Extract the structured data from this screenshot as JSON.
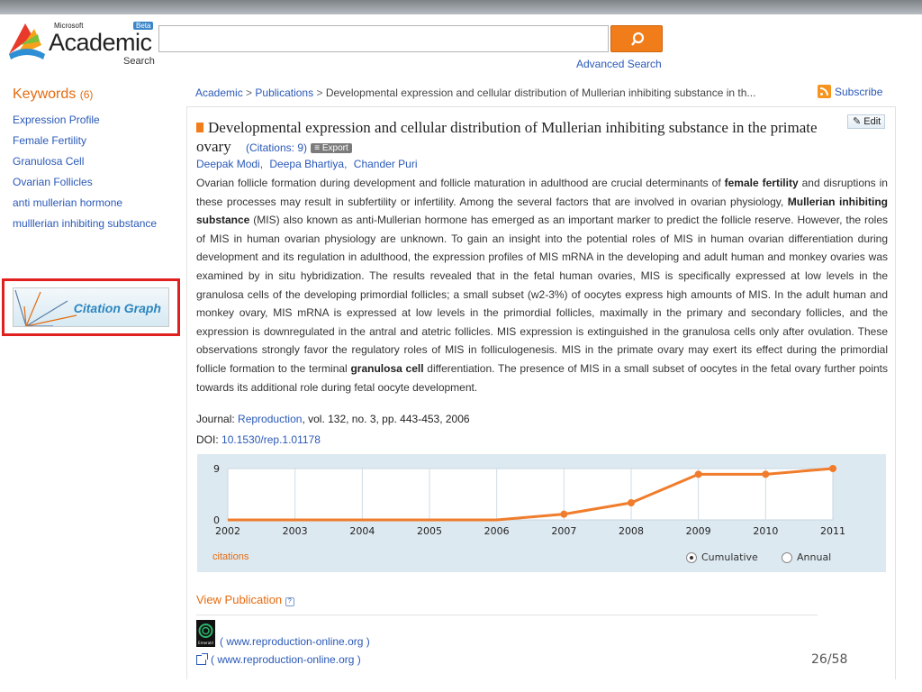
{
  "header": {
    "logo_brand": "Microsoft",
    "logo_beta": "Beta",
    "logo_main": "Academic",
    "logo_sub": "Search",
    "search_value": "",
    "advanced_search": "Advanced Search"
  },
  "keywords": {
    "title": "Keywords",
    "count": "(6)",
    "items": [
      "Expression Profile",
      "Female Fertility",
      "Granulosa Cell",
      "Ovarian Follicles",
      "anti mullerian hormone",
      "mulllerian inhibiting substance"
    ]
  },
  "citation_graph": {
    "label": "Citation Graph"
  },
  "breadcrumb": {
    "items": [
      "Academic",
      "Publications"
    ],
    "current": "Developmental expression and cellular distribution of Mullerian inhibiting substance in th...",
    "separator": ">"
  },
  "subscribe": "Subscribe",
  "edit": "Edit",
  "publication": {
    "title": "Developmental expression and cellular distribution of Mullerian inhibiting substance in the primate ovary",
    "citations": "(Citations: 9)",
    "export": "Export",
    "authors": [
      "Deepak Modi,",
      "Deepa Bhartiya,",
      "Chander Puri"
    ],
    "abstract_parts": [
      "Ovarian follicle formation during development and follicle maturation in adulthood are crucial determinants of ",
      "female fertility",
      " and disruptions in these processes may result in subfertility or infertility. Among the several factors that are involved in ovarian physiology, ",
      "Mullerian inhibiting substance",
      " (MIS) also known as anti-Mullerian hormone has emerged as an important marker to predict the follicle reserve. However, the roles of MIS in human ovarian physiology are unknown. To gain an insight into the potential roles of MIS in human ovarian differentiation during development and its regulation in adulthood, the expression profiles of MIS mRNA in the developing and adult human and monkey ovaries was examined by in situ hybridization. The results revealed that in the fetal human ovaries, MIS is specifically expressed at low levels in the granulosa cells of the developing primordial follicles; a small subset (w2-3%) of oocytes express high amounts of MIS. In the adult human and monkey ovary, MIS mRNA is expressed at low levels in the primordial follicles, maximally in the primary and secondary follicles, and the expression is downregulated in the antral and atetric follicles. MIS expression is extinguished in the granulosa cells only after ovulation. These observations strongly favor the regulatory roles of MIS in folliculogenesis. MIS in the primate ovary may exert its effect during the primordial follicle formation to the terminal ",
      "granulosa cell",
      " differentiation. The presence of MIS in a small subset of oocytes in the fetal ovary further points towards its additional role during fetal oocyte development."
    ],
    "journal_label": "Journal:",
    "journal_name": "Reproduction",
    "journal_details": ", vol. 132, no. 3, pp. 443-453, 2006",
    "doi_label": "DOI:",
    "doi": "10.1530/rep.1.01178"
  },
  "chart_data": {
    "type": "line",
    "x": [
      "2002",
      "2003",
      "2004",
      "2005",
      "2006",
      "2007",
      "2008",
      "2009",
      "2010",
      "2011"
    ],
    "series": [
      {
        "name": "citations",
        "values": [
          0,
          0,
          0,
          0,
          0,
          1,
          3,
          8,
          8,
          9
        ]
      }
    ],
    "ylim": [
      0,
      9
    ],
    "ytick_labels": [
      "0",
      "9"
    ],
    "grid": true,
    "line_color": "#f07c2c",
    "legend_label": "citations",
    "mode_options": [
      "Cumulative",
      "Annual"
    ],
    "mode_selected": "Cumulative"
  },
  "view_publication": {
    "label": "View Publication",
    "sources": [
      "( www.reproduction-online.org )",
      "( www.reproduction-online.org )"
    ],
    "source_logo_text": "Emerald"
  },
  "page_indicator": "26/58",
  "colors": {
    "accent_orange": "#e46b10",
    "link_blue": "#2a59b8",
    "highlight_red": "#e01f1f"
  }
}
